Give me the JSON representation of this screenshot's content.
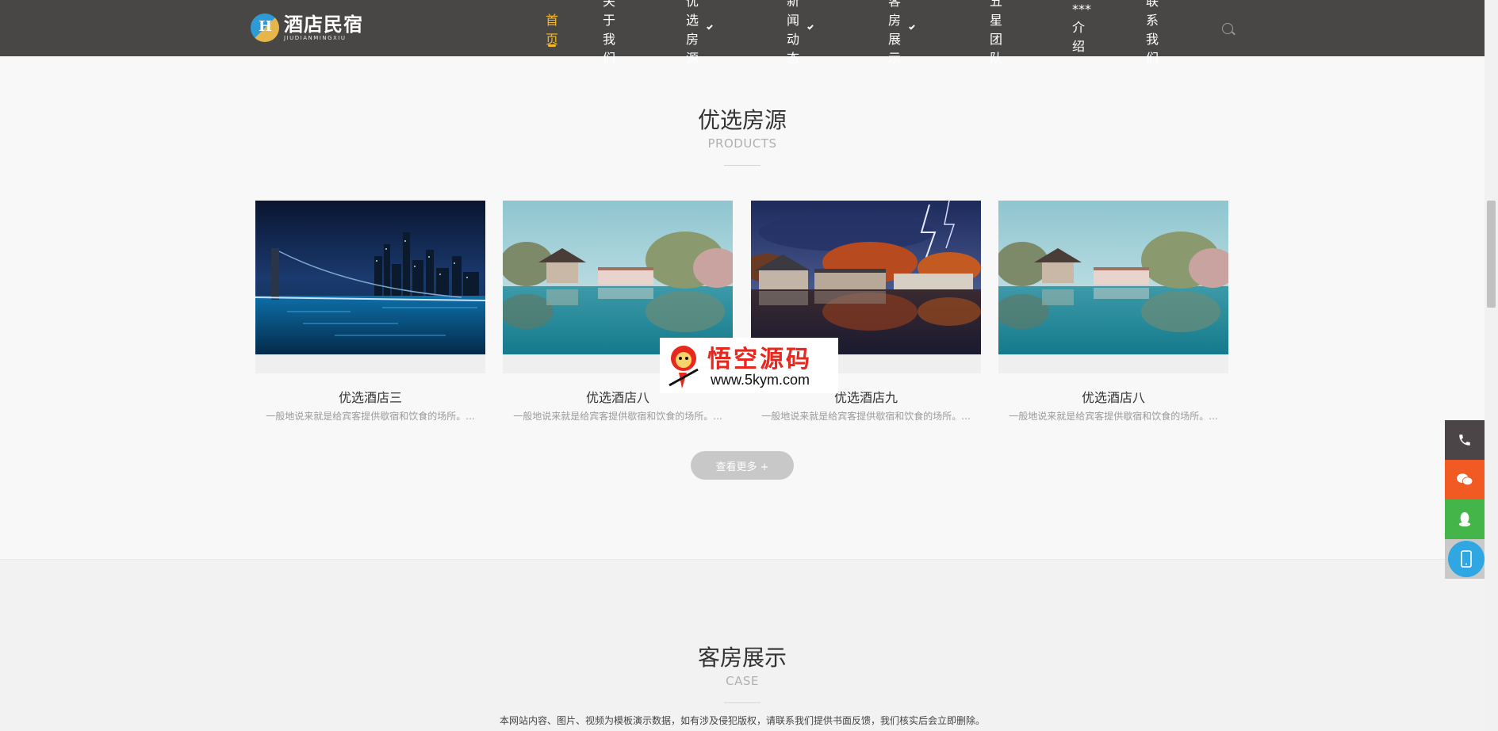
{
  "brand": {
    "name_cn": "酒店民宿",
    "name_en": "JIUDIANMINGXIU"
  },
  "nav": {
    "items": [
      {
        "label": "首页",
        "active": true,
        "dropdown": false
      },
      {
        "label": "关于我们",
        "active": false,
        "dropdown": false
      },
      {
        "label": "优选房源",
        "active": false,
        "dropdown": true
      },
      {
        "label": "新闻动态",
        "active": false,
        "dropdown": true
      },
      {
        "label": "客房展示",
        "active": false,
        "dropdown": true
      },
      {
        "label": "五星团队",
        "active": false,
        "dropdown": false
      },
      {
        "label": "***介绍",
        "active": false,
        "dropdown": false
      },
      {
        "label": "联系我们",
        "active": false,
        "dropdown": false
      }
    ]
  },
  "products": {
    "title": "优选房源",
    "subtitle": "PRODUCTS",
    "items": [
      {
        "name": "优选酒店三",
        "desc": "一般地说来就是给宾客提供歇宿和饮食的场所。...",
        "image": "night-city-bridge"
      },
      {
        "name": "优选酒店八",
        "desc": "一般地说来就是给宾客提供歇宿和饮食的场所。...",
        "image": "lake-pavilion"
      },
      {
        "name": "优选酒店九",
        "desc": "一般地说来就是给宾客提供歇宿和饮食的场所。...",
        "image": "storm-lake-houses"
      },
      {
        "name": "优选酒店八",
        "desc": "一般地说来就是给宾客提供歇宿和饮食的场所。...",
        "image": "lake-pavilion"
      }
    ],
    "more_label": "查看更多 +"
  },
  "rooms": {
    "title": "客房展示",
    "subtitle": "CASE"
  },
  "watermark": {
    "text_cn": "悟空源码",
    "text_en": "www.5kym.com"
  },
  "notice": "本网站内容、图片、视频为模板演示数据，如有涉及侵犯版权，请联系我们提供书面反馈，我们核实后会立即删除。",
  "float_bar": {
    "items": [
      "phone-icon",
      "wechat-icon",
      "qq-icon",
      "mobile-icon"
    ]
  },
  "colors": {
    "header_bg": "#484746",
    "accent": "#f5b928",
    "phone": "#4c4548",
    "wechat": "#f25a23",
    "qq": "#44b549",
    "mobile": "#2fa7e3"
  }
}
